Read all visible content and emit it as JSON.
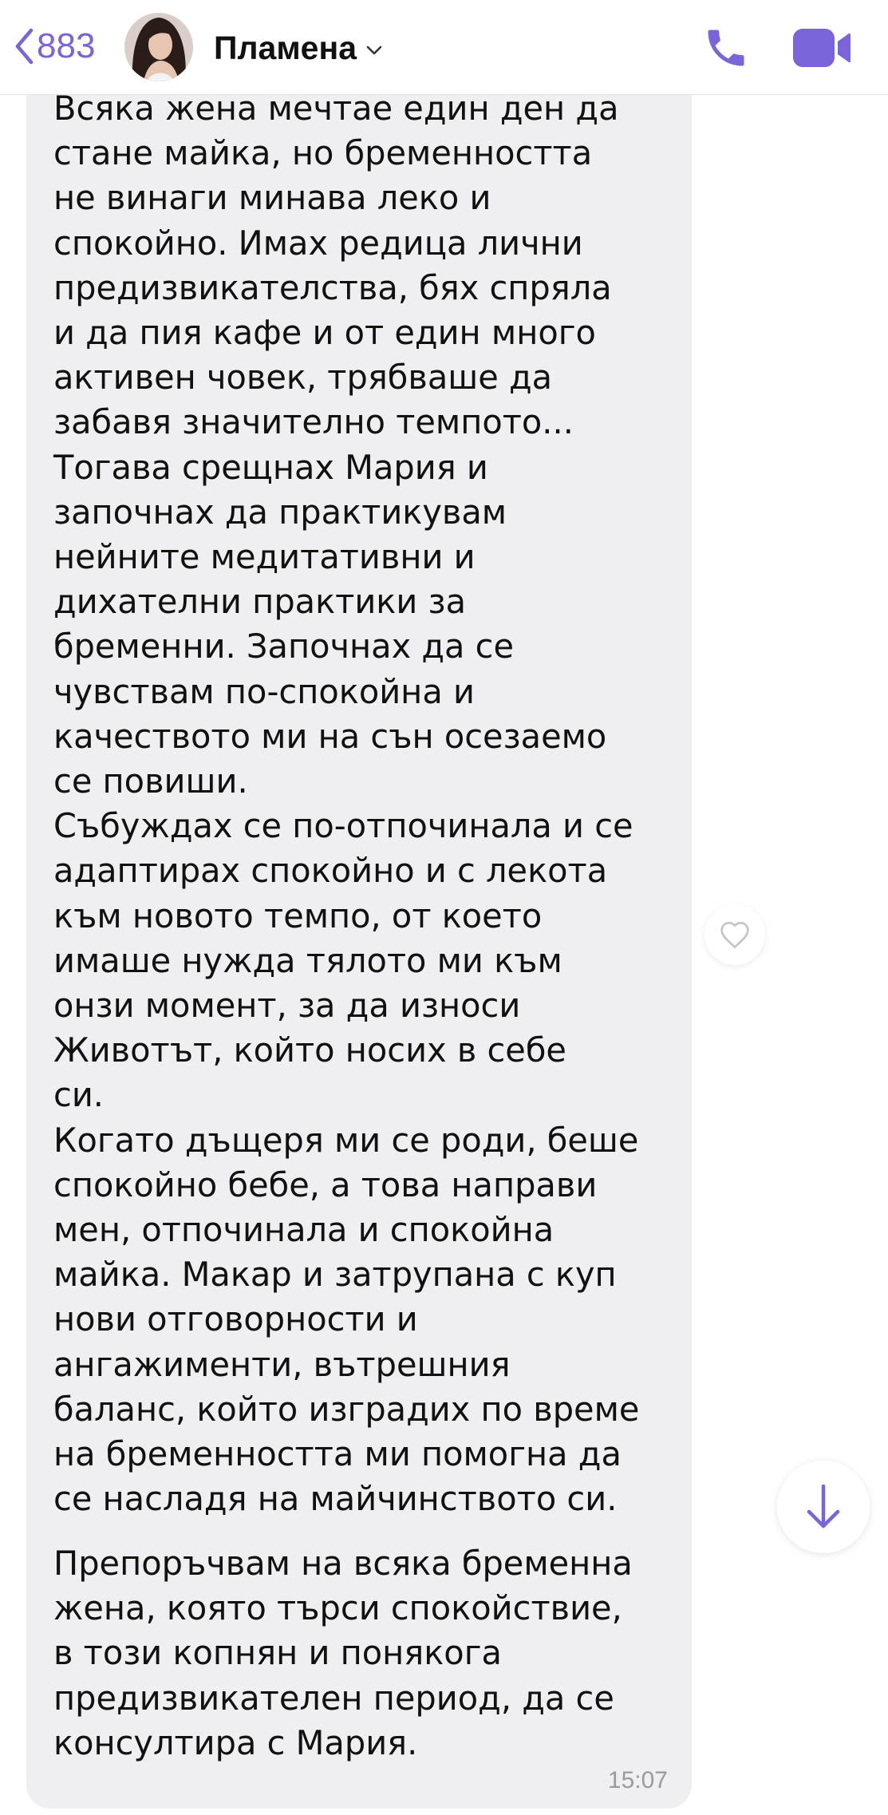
{
  "header": {
    "back_count": "883",
    "contact_name": "Пламена",
    "icons": [
      "back-chevron-icon",
      "avatar",
      "chevron-down-icon",
      "phone-icon",
      "video-camera-icon"
    ],
    "accent_color": "#7b63d9"
  },
  "message": {
    "paragraph_1": "Всяка жена мечтае един ден да\nстане майка, но бременността\nне винаги минава леко и\nспокойно. Имах редица лични\nпредизвикателства, бях спряла\nи да пия кафе и от един много\nактивен човек, трябваше да\nзабавя значително темпото...\nТогава срещнах Мария и\nзапочнах да практикувам\nнейните медитативни и\nдихателни  практики за\nбременни. Започнах да се\nчувствам по-спокойна и\nкачеството ми на сън осезаемо\nсе повиши.\nСъбуждах се по-отпочинала и се\nадаптирах спокойно и с лекота\nкъм новото темпо, от което\nимаше нужда тялото ми към\nонзи момент, за да износи\nЖивотът, който носих в себе\nси.\nКогато дъщеря ми се роди, беше\nспокойно бебе, а това направи\nмен, отпочинала и спокойна\nмайка. Макар и затрупана с куп\nнови отговорности и\nангажименти, вътрешния\nбаланс, който изградих по време\nна бременността ми помогна да\nсе насладя на майчинството си.",
    "paragraph_2": "Препоръчвам на всяка бременна\nжена, която търси спокойствие,\nв този копнян и понякога\nпредизвикателен период, да се\nконсултира с Мария.",
    "time": "15:07",
    "bubble_color": "#efeff1"
  },
  "actions": {
    "like_icon": "heart-outline-icon",
    "scroll_icon": "arrow-down-icon"
  }
}
